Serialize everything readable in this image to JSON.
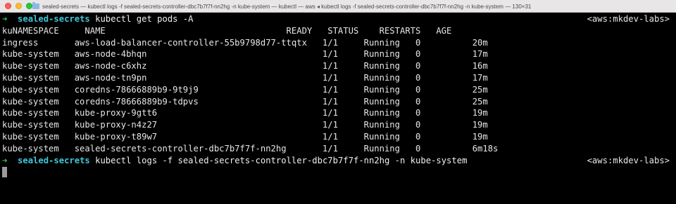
{
  "window": {
    "title": "sealed-secrets — kubectl logs -f sealed-secrets-controller-dbc7b7f7f-nn2hg -n kube-system — kubectl — aws ◂ kubectl logs -f sealed-secrets-controller-dbc7b7f7f-nn2hg -n kube-system — 130×31"
  },
  "prompts": [
    {
      "arrow": "➜",
      "directory": "sealed-secrets",
      "command": "kubectl get pods -A",
      "context": "<aws:mkdev-labs>"
    },
    {
      "arrow": "➜",
      "directory": "sealed-secrets",
      "command": "kubectl logs -f sealed-secrets-controller-dbc7b7f7f-nn2hg -n kube-system",
      "context": "<aws:mkdev-labs>"
    }
  ],
  "table": {
    "header": "kuNAMESPACE     NAME                                   READY   STATUS    RESTARTS   AGE",
    "rows": [
      "ingress       aws-load-balancer-controller-55b9798d77-ttqtx   1/1     Running   0          20m",
      "kube-system   aws-node-4bhqn                                  1/1     Running   0          17m",
      "kube-system   aws-node-c6xhz                                  1/1     Running   0          16m",
      "kube-system   aws-node-tn9pn                                  1/1     Running   0          17m",
      "kube-system   coredns-78666889b9-9t9j9                        1/1     Running   0          25m",
      "kube-system   coredns-78666889b9-tdpvs                        1/1     Running   0          25m",
      "kube-system   kube-proxy-9gtt6                                1/1     Running   0          19m",
      "kube-system   kube-proxy-n4z27                                1/1     Running   0          19m",
      "kube-system   kube-proxy-t89w7                                1/1     Running   0          19m",
      "kube-system   sealed-secrets-controller-dbc7b7f7f-nn2hg       1/1     Running   0          6m18s"
    ]
  },
  "colors": {
    "background": "#000000",
    "prompt_arrow": "#2ecc40",
    "prompt_directory": "#3fc7d8",
    "text": "#e6e6e6"
  }
}
